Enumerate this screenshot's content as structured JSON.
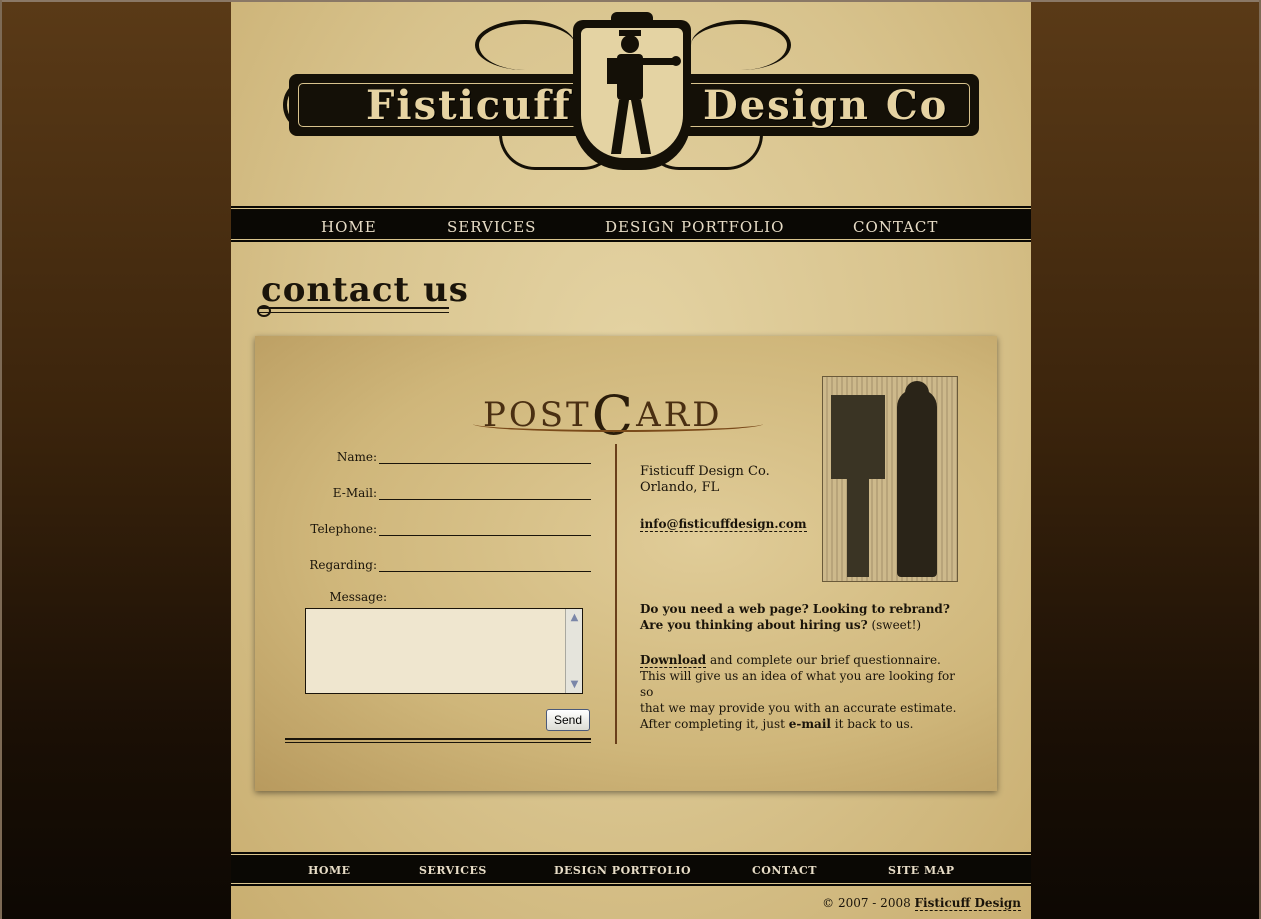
{
  "header": {
    "brand_left": "Fisticuff",
    "brand_right": "Design Co"
  },
  "nav": {
    "items": [
      "HOME",
      "SERVICES",
      "DESIGN PORTFOLIO",
      "CONTACT"
    ]
  },
  "page_heading": "contact us",
  "postcard": {
    "title_left": "POST",
    "title_c": "C",
    "title_right": "ARD",
    "form": {
      "name_label": "Name:",
      "email_label": "E-Mail:",
      "telephone_label": "Telephone:",
      "regarding_label": "Regarding:",
      "message_label": "Message:",
      "name_value": "",
      "email_value": "",
      "telephone_value": "",
      "regarding_value": "",
      "message_value": "",
      "send_label": "Send"
    },
    "info": {
      "company": "Fisticuff Design Co.",
      "location": "Orlando, FL",
      "email": "info@fisticuffdesign.com",
      "pitch_line1": "Do you need a web page? Looking to rebrand?",
      "pitch_line2": "Are you thinking about hiring us?",
      "pitch_aside": "(sweet!)",
      "download_link": "Download",
      "download_text1": " and complete our brief questionnaire.",
      "download_text2": "This will give us an idea of what you are looking for so",
      "download_text3": "that we may provide you with an accurate estimate.",
      "download_text4_a": "After completing it, just ",
      "download_email_link": "e-mail",
      "download_text4_b": " it back to us."
    }
  },
  "footer": {
    "nav_items": [
      "HOME",
      "SERVICES",
      "DESIGN PORTFOLIO",
      "CONTACT",
      "SITE MAP"
    ],
    "copyright_prefix": "© 2007 - 2008 ",
    "copyright_link": "Fisticuff Design"
  },
  "colors": {
    "background_dark": "#3b240c",
    "parchment": "#d8c38d",
    "ink": "#1a140a",
    "nav_bar": "#0a0804"
  }
}
